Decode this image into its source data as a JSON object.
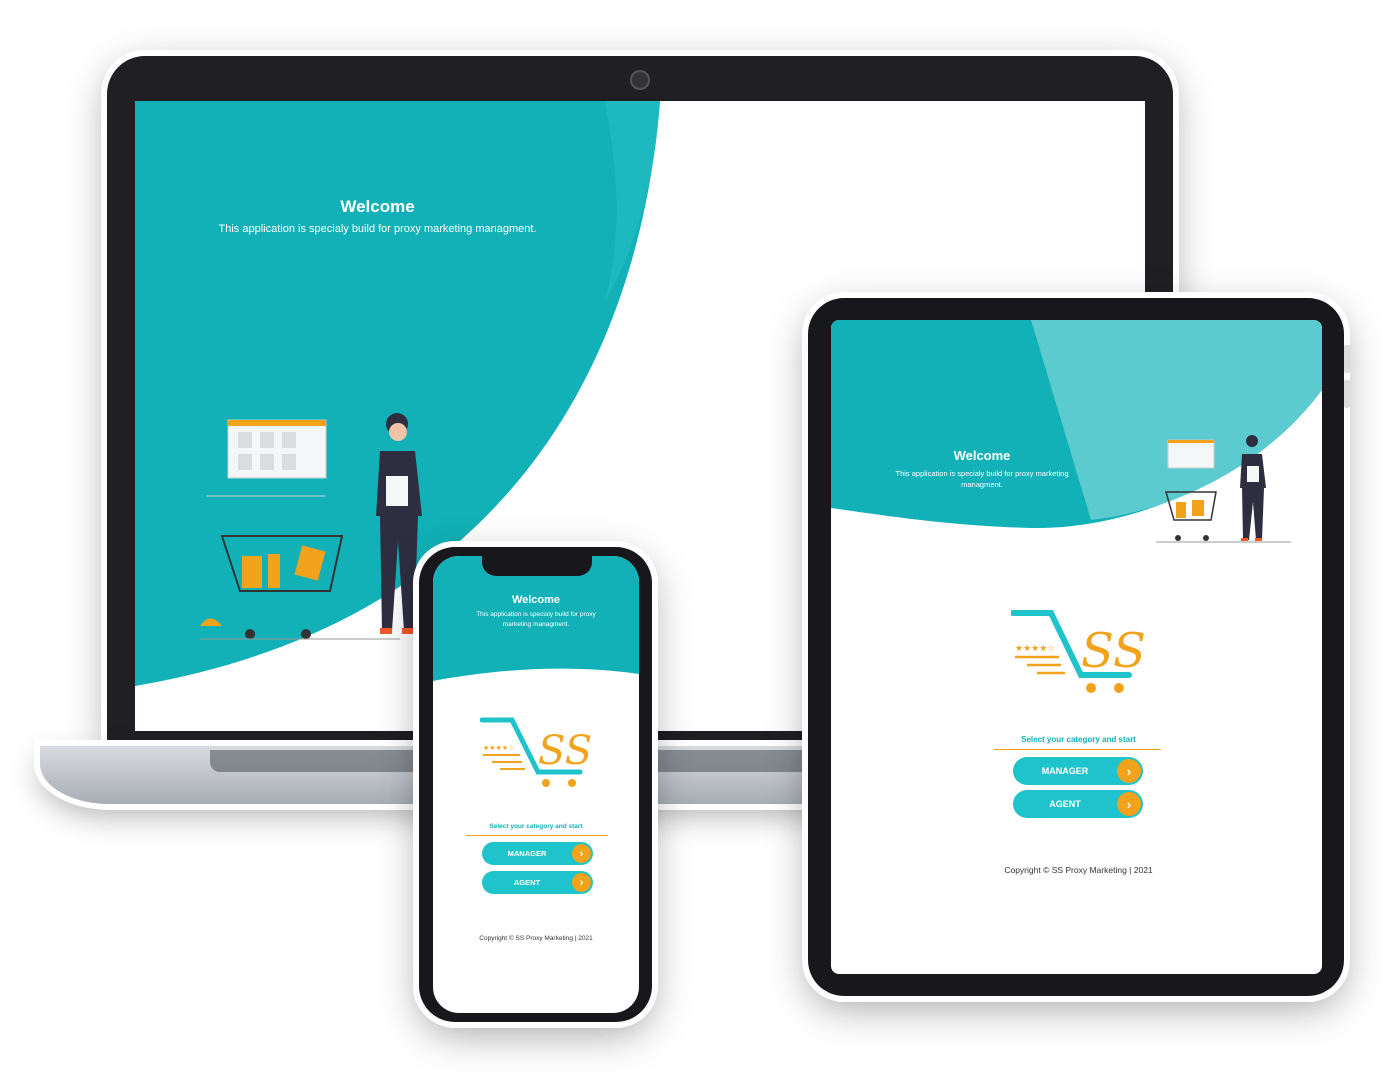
{
  "app": {
    "welcome_title": "Welcome",
    "welcome_text": "This application is specialy build for proxy marketing managment.",
    "select_label": "Select your category and start",
    "manager_label": "MANAGER",
    "agent_label": "AGENT",
    "copyright": "Copyright © SS Proxy Marketing | 2021",
    "logo_text": "SS"
  },
  "colors": {
    "teal": "#11b1b7",
    "teal_light": "#5ccbcf",
    "accent_orange": "#f2a31b",
    "button": "#1fc3cb"
  },
  "icons": {
    "arrow": "chevron-right-icon",
    "cart": "shopping-cart-icon"
  }
}
